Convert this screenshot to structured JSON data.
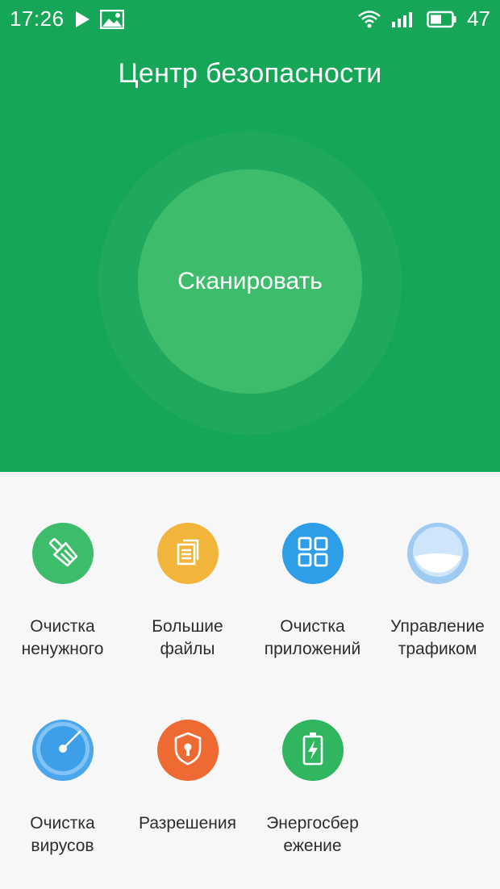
{
  "status_bar": {
    "time": "17:26",
    "battery_level": "47",
    "icons": [
      "play-icon",
      "image-icon",
      "wifi-icon",
      "signal-icon",
      "battery-icon"
    ]
  },
  "header": {
    "title": "Центр безопасности"
  },
  "scan": {
    "label": "Сканировать"
  },
  "colors": {
    "primary_green": "#16a657",
    "scan_circle": "#3dbd6b",
    "background": "#f7f7f7"
  },
  "tools": [
    {
      "icon": "broom-icon",
      "color": "#3dbd6b",
      "line1": "Очистка",
      "line2": "ненужного"
    },
    {
      "icon": "files-icon",
      "color": "#f0b53a",
      "line1": "Большие",
      "line2": "файлы"
    },
    {
      "icon": "apps-grid-icon",
      "color": "#2f9ee8",
      "line1": "Очистка",
      "line2": "приложений"
    },
    {
      "icon": "traffic-icon",
      "color": "#9fcbf2",
      "line1": "Управление",
      "line2": "трафиком"
    },
    {
      "icon": "radar-icon",
      "color": "#4aa7eb",
      "line1": "Очистка",
      "line2": "вирусов"
    },
    {
      "icon": "shield-lock-icon",
      "color": "#ef6a32",
      "line1": "Разрешения",
      "line2": ""
    },
    {
      "icon": "battery-charge-icon",
      "color": "#2fb65f",
      "line1": "Энергосбер",
      "line2": "ежение"
    }
  ]
}
